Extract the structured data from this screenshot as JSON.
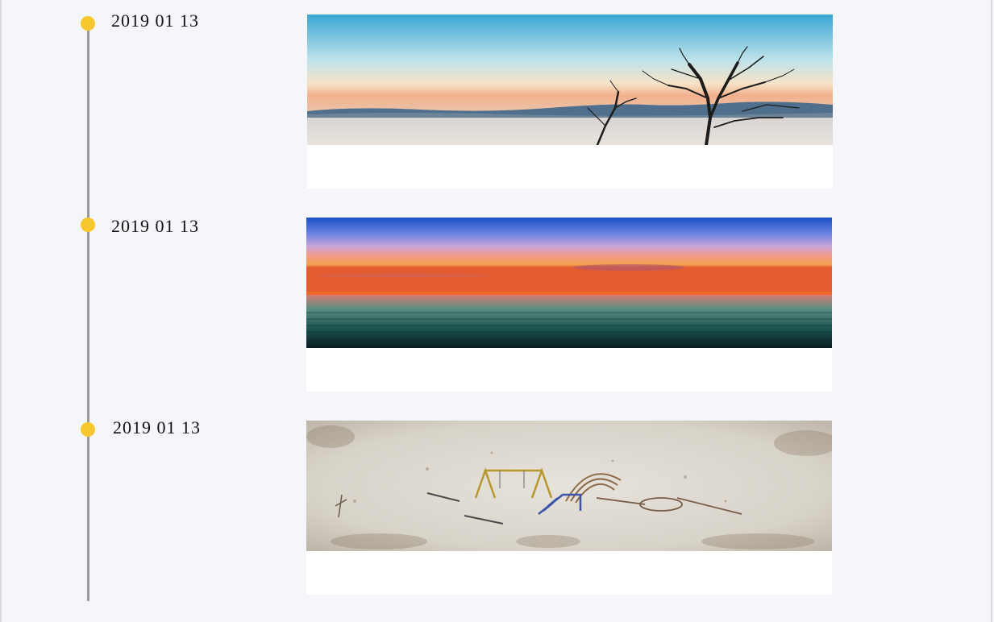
{
  "timeline": {
    "entries": [
      {
        "date": "2019 01 13",
        "scene": "lake-at-dawn-with-bare-tree",
        "caption": ""
      },
      {
        "date": "2019 01 13",
        "scene": "sea-sunset-horizon",
        "caption": ""
      },
      {
        "date": "2019 01 13",
        "scene": "miniature-playground-in-sand",
        "caption": ""
      }
    ]
  },
  "colors": {
    "background": "#f5f6f9",
    "line": "#9a9a9a",
    "dot": "#f8c62d"
  }
}
